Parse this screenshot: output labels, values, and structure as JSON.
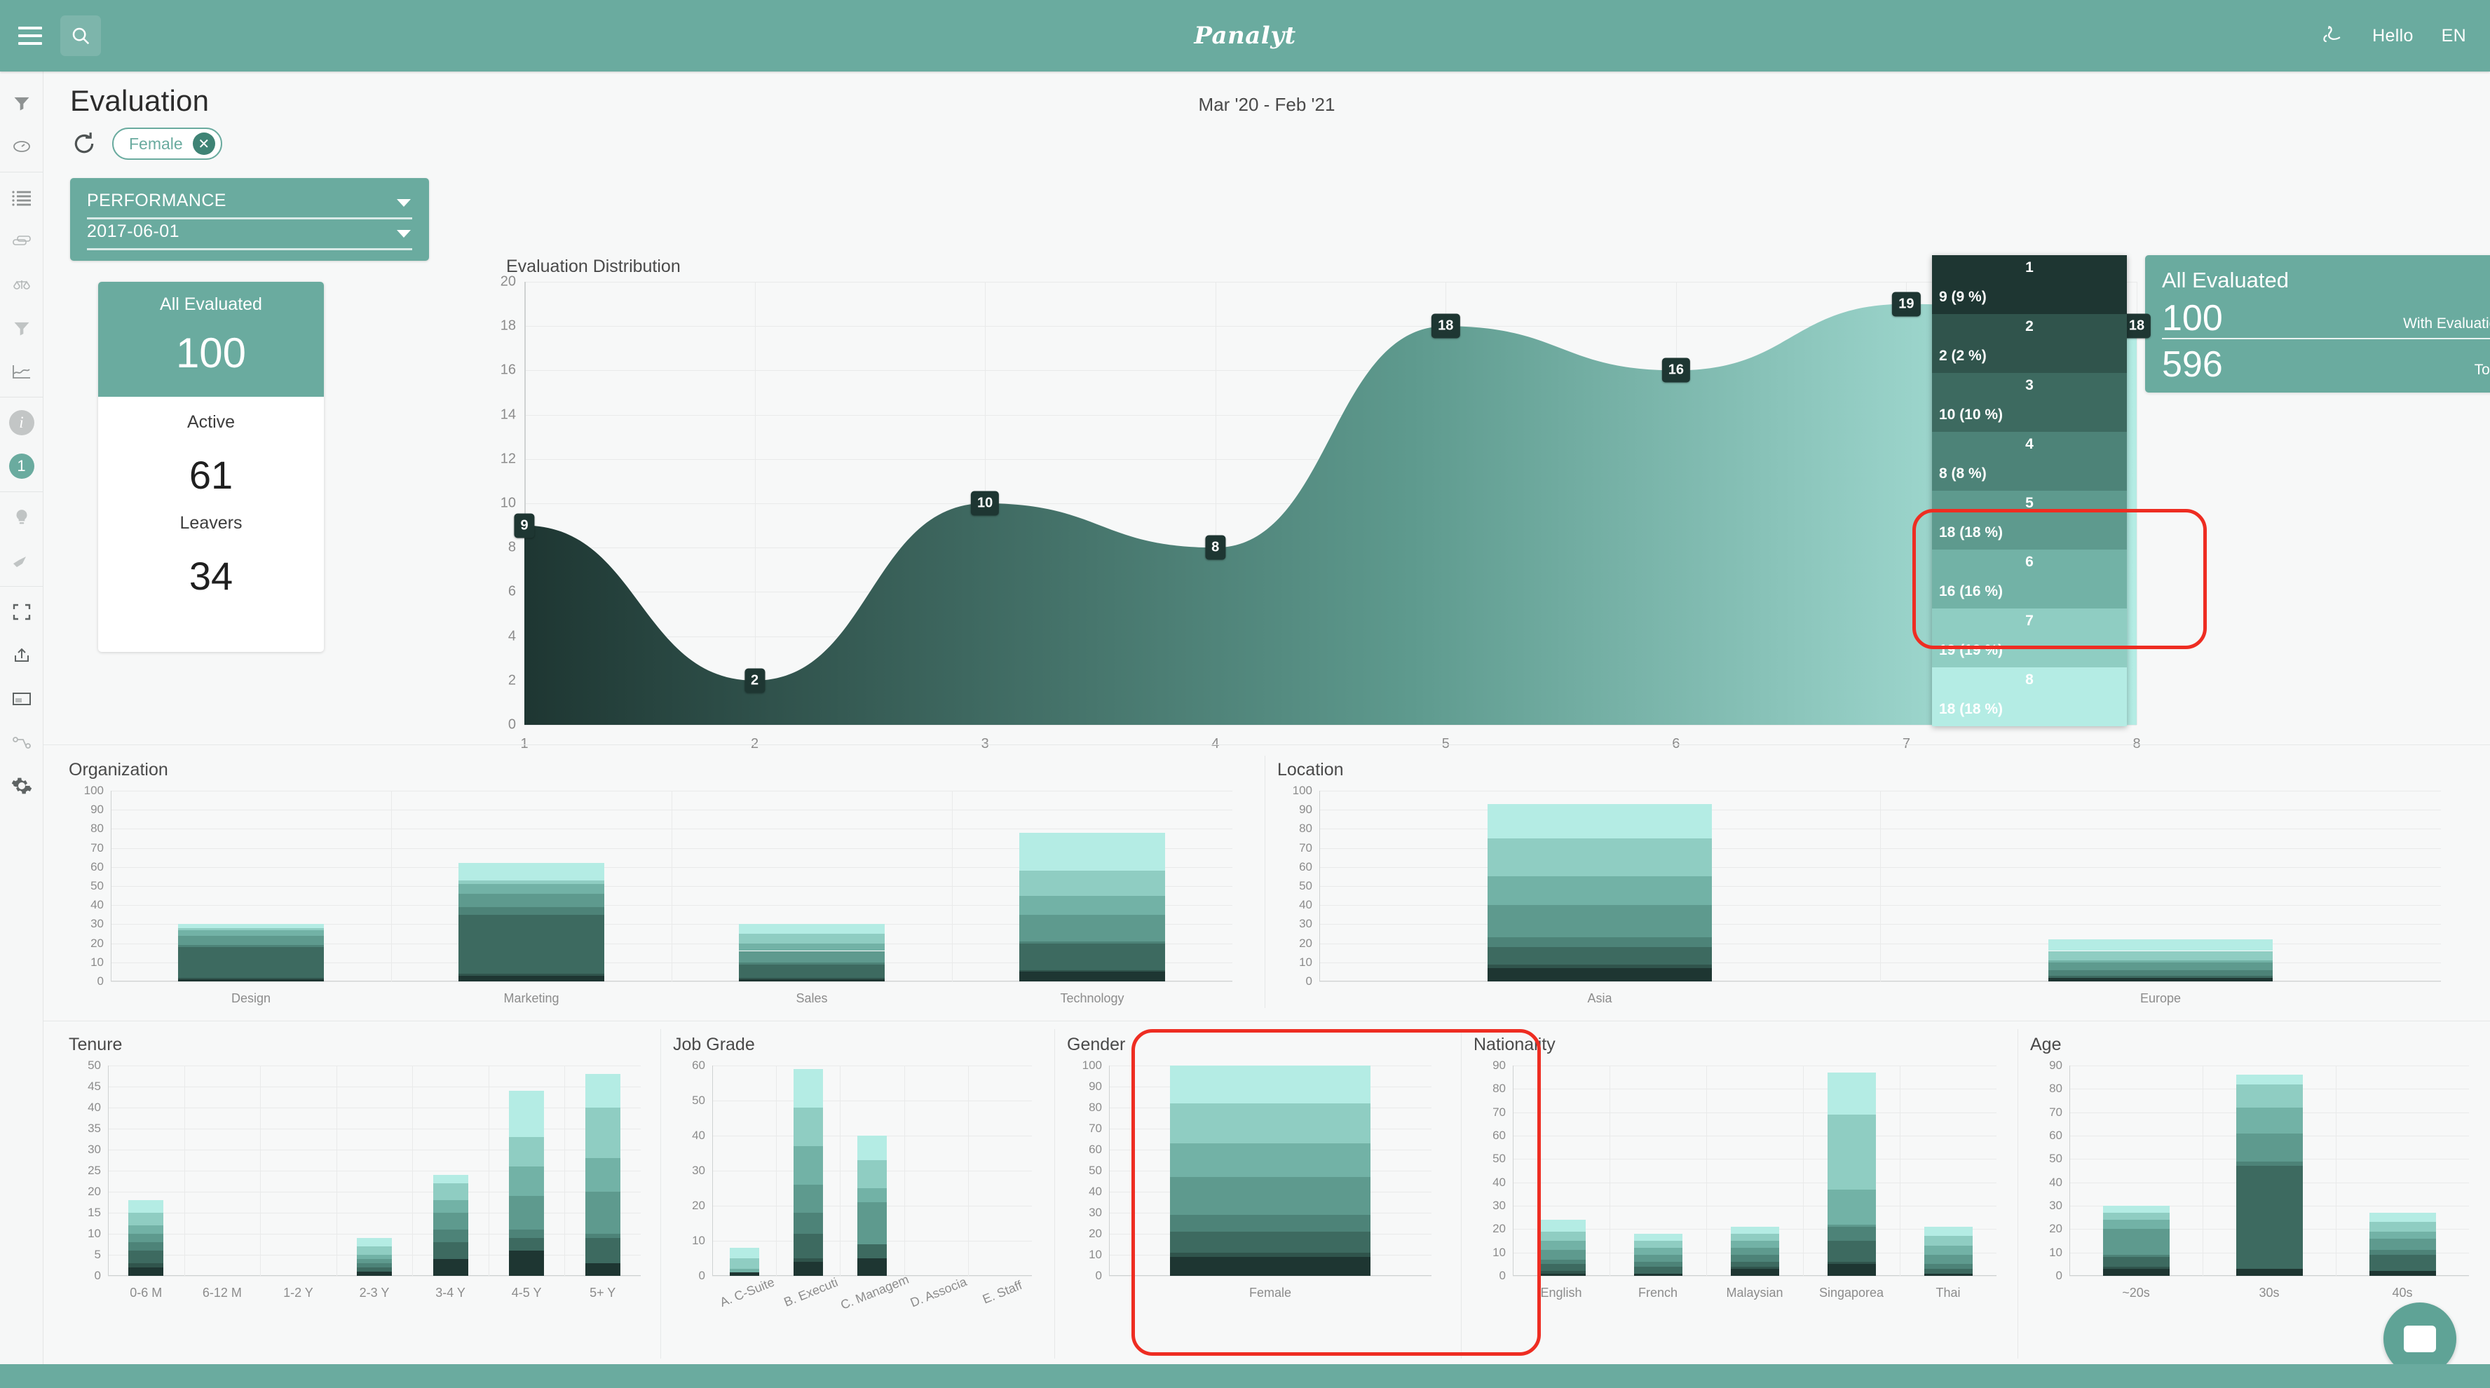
{
  "header": {
    "logo": "Panalyt",
    "logo_icon": "panalyt-script-logo",
    "menu_icon": "hamburger-menu-icon",
    "search_icon": "search-icon",
    "bird_icon": "swan-icon",
    "hello": "Hello",
    "lang": "EN"
  },
  "sidebar": {
    "items": [
      {
        "name": "filter-icon",
        "label": "Filter"
      },
      {
        "name": "clock-history-icon",
        "label": "History"
      },
      {
        "name": "list-icon",
        "label": "List"
      },
      {
        "name": "layers-icon",
        "label": "Layers"
      },
      {
        "name": "balance-scale-icon",
        "label": "Compare"
      },
      {
        "name": "funnel-icon",
        "label": "Funnel"
      },
      {
        "name": "chart-line-icon",
        "label": "Trends"
      },
      {
        "name": "info-icon",
        "label": "Info"
      },
      {
        "name": "notification-count-icon",
        "label": "1"
      },
      {
        "name": "lightbulb-icon",
        "label": "Insights"
      },
      {
        "name": "rocket-icon",
        "label": "Launch"
      },
      {
        "name": "fullscreen-icon",
        "label": "Fullscreen"
      },
      {
        "name": "upload-share-icon",
        "label": "Share"
      },
      {
        "name": "presentation-icon",
        "label": "Present"
      },
      {
        "name": "node-link-icon",
        "label": "Network"
      },
      {
        "name": "gear-icon",
        "label": "Settings"
      }
    ],
    "notification_count": "1"
  },
  "page": {
    "title": "Evaluation",
    "date_range": "Mar '20 - Feb '21",
    "reload_icon": "reload-icon",
    "filter_chip": {
      "label": "Female",
      "remove_icon": "close-icon"
    }
  },
  "selectors": {
    "metric": "PERFORMANCE",
    "date": "2017-06-01",
    "caret_icon": "chevron-down-icon"
  },
  "kpi_card": {
    "header_label": "All Evaluated",
    "header_value": "100",
    "rows": [
      {
        "label": "Active",
        "value": "61"
      },
      {
        "label": "Leavers",
        "value": "34"
      }
    ]
  },
  "banner": {
    "title": "All Evaluated",
    "with_evaluation_value": "100",
    "with_evaluation_label": "With Evaluation",
    "total_value": "596",
    "total_label": "Total"
  },
  "tooltip": {
    "rows": [
      {
        "key": "1",
        "value": "9 (9 %)",
        "color": "#1e3632"
      },
      {
        "key": "2",
        "value": "2 (2 %)",
        "color": "#30544c"
      },
      {
        "key": "3",
        "value": "10 (10 %)",
        "color": "#3d6a60"
      },
      {
        "key": "4",
        "value": "8 (8 %)",
        "color": "#4d8378"
      },
      {
        "key": "5",
        "value": "18 (18 %)",
        "color": "#5e9a8e"
      },
      {
        "key": "6",
        "value": "16 (16 %)",
        "color": "#72b2a6"
      },
      {
        "key": "7",
        "value": "19 (19 %)",
        "color": "#8fcdc2"
      },
      {
        "key": "8",
        "value": "18 (18 %)",
        "color": "#b4ece4"
      }
    ]
  },
  "palette": {
    "brand": "#6aab9f",
    "dark": "#1e3632",
    "light": "#b4ece4",
    "highlight": "#ee2d22",
    "ramp": [
      "#1e3632",
      "#2c4b44",
      "#3a6056",
      "#487569",
      "#5a8d81",
      "#6ea79a",
      "#85c2b6",
      "#a9e2d9",
      "#b9eee6"
    ]
  },
  "chart_data": [
    {
      "type": "area",
      "title": "Evaluation Distribution",
      "categories": [
        "1",
        "2",
        "3",
        "4",
        "5",
        "6",
        "7",
        "8"
      ],
      "values": [
        9,
        2,
        10,
        8,
        18,
        16,
        19,
        18
      ],
      "xlabel": "",
      "ylabel": "",
      "ylim": [
        0,
        20
      ],
      "yticks": [
        0,
        2,
        4,
        6,
        8,
        10,
        12,
        14,
        16,
        18,
        20
      ],
      "grid": true,
      "legend": "none",
      "point_labels": [
        "9",
        "2",
        "10",
        "8",
        "18",
        "16",
        "19",
        "18"
      ]
    },
    {
      "type": "bar",
      "title": "Organization",
      "stacked": true,
      "categories": [
        "Design",
        "Marketing",
        "Sales",
        "Technology"
      ],
      "values": [
        30,
        62,
        30,
        78
      ],
      "ylim": [
        0,
        100
      ],
      "yticks": [
        0,
        10,
        20,
        30,
        40,
        50,
        60,
        70,
        80,
        90,
        100
      ],
      "series": [
        {
          "name": "1",
          "values": [
            1,
            3,
            1,
            5
          ]
        },
        {
          "name": "2",
          "values": [
            1,
            1,
            1,
            1
          ]
        },
        {
          "name": "3",
          "values": [
            16,
            31,
            7,
            14
          ]
        },
        {
          "name": "4",
          "values": [
            1,
            4,
            1,
            1
          ]
        },
        {
          "name": "5",
          "values": [
            5,
            7,
            6,
            14
          ]
        },
        {
          "name": "6",
          "values": [
            3,
            5,
            4,
            10
          ]
        },
        {
          "name": "7",
          "values": [
            1,
            2,
            5,
            13
          ]
        },
        {
          "name": "8",
          "values": [
            2,
            9,
            5,
            20
          ]
        }
      ]
    },
    {
      "type": "bar",
      "title": "Location",
      "stacked": true,
      "categories": [
        "Asia",
        "Europe"
      ],
      "values": [
        93,
        22
      ],
      "ylim": [
        0,
        100
      ],
      "yticks": [
        0,
        10,
        20,
        30,
        40,
        50,
        60,
        70,
        80,
        90,
        100
      ],
      "series": [
        {
          "name": "1",
          "values": [
            7,
            2
          ]
        },
        {
          "name": "2",
          "values": [
            2,
            0
          ]
        },
        {
          "name": "3",
          "values": [
            9,
            1
          ]
        },
        {
          "name": "4",
          "values": [
            5,
            3
          ]
        },
        {
          "name": "5",
          "values": [
            17,
            4
          ]
        },
        {
          "name": "6",
          "values": [
            15,
            1
          ]
        },
        {
          "name": "7",
          "values": [
            20,
            5
          ]
        },
        {
          "name": "8",
          "values": [
            18,
            6
          ]
        }
      ]
    },
    {
      "type": "bar",
      "title": "Tenure",
      "stacked": true,
      "categories": [
        "0-6 M",
        "6-12 M",
        "1-2 Y",
        "2-3 Y",
        "3-4 Y",
        "4-5 Y",
        "5+ Y"
      ],
      "values": [
        18,
        0,
        0,
        8,
        24,
        44,
        48
      ],
      "ylim": [
        0,
        50
      ],
      "yticks": [
        0,
        5,
        10,
        15,
        20,
        25,
        30,
        35,
        40,
        45,
        50
      ],
      "series": [
        {
          "name": "1",
          "values": [
            2,
            0,
            0,
            1,
            4,
            6,
            3
          ]
        },
        {
          "name": "2",
          "values": [
            1,
            0,
            0,
            0,
            0,
            0,
            0
          ]
        },
        {
          "name": "3",
          "values": [
            3,
            0,
            0,
            1,
            4,
            3,
            6
          ]
        },
        {
          "name": "4",
          "values": [
            2,
            0,
            0,
            1,
            3,
            2,
            1
          ]
        },
        {
          "name": "5",
          "values": [
            2,
            0,
            0,
            1,
            4,
            8,
            10
          ]
        },
        {
          "name": "6",
          "values": [
            2,
            0,
            0,
            1,
            3,
            7,
            8
          ]
        },
        {
          "name": "7",
          "values": [
            3,
            0,
            0,
            2,
            4,
            7,
            12
          ]
        },
        {
          "name": "8",
          "values": [
            3,
            0,
            0,
            2,
            2,
            11,
            8
          ]
        }
      ]
    },
    {
      "type": "bar",
      "title": "Job Grade",
      "stacked": true,
      "categories": [
        "A. C-Suite",
        "B. Executi",
        "C. Managem",
        "D. Associa",
        "E. Staff"
      ],
      "values": [
        8,
        59,
        40,
        0,
        0
      ],
      "ylim": [
        0,
        60
      ],
      "yticks": [
        0,
        10,
        20,
        30,
        40,
        50,
        60
      ],
      "series": [
        {
          "name": "1",
          "values": [
            1,
            4,
            5,
            0,
            0
          ]
        },
        {
          "name": "2",
          "values": [
            0,
            1,
            0,
            0,
            0
          ]
        },
        {
          "name": "3",
          "values": [
            0,
            7,
            4,
            0,
            0
          ]
        },
        {
          "name": "4",
          "values": [
            0,
            6,
            0,
            0,
            0
          ]
        },
        {
          "name": "5",
          "values": [
            0,
            8,
            12,
            0,
            0
          ]
        },
        {
          "name": "6",
          "values": [
            1,
            11,
            4,
            0,
            0
          ]
        },
        {
          "name": "7",
          "values": [
            3,
            11,
            8,
            0,
            0
          ]
        },
        {
          "name": "8",
          "values": [
            3,
            11,
            7,
            0,
            0
          ]
        }
      ]
    },
    {
      "type": "bar",
      "title": "Gender",
      "stacked": true,
      "categories": [
        "Female"
      ],
      "values": [
        100
      ],
      "ylim": [
        0,
        100
      ],
      "yticks": [
        0,
        10,
        20,
        30,
        40,
        50,
        60,
        70,
        80,
        90,
        100
      ],
      "series": [
        {
          "name": "1",
          "values": [
            9
          ]
        },
        {
          "name": "2",
          "values": [
            2
          ]
        },
        {
          "name": "3",
          "values": [
            10
          ]
        },
        {
          "name": "4",
          "values": [
            8
          ]
        },
        {
          "name": "5",
          "values": [
            18
          ]
        },
        {
          "name": "6",
          "values": [
            16
          ]
        },
        {
          "name": "7",
          "values": [
            19
          ]
        },
        {
          "name": "8",
          "values": [
            18
          ]
        }
      ]
    },
    {
      "type": "bar",
      "title": "Nationality",
      "stacked": true,
      "categories": [
        "English",
        "French",
        "Malaysian",
        "Singaporea",
        "Thai"
      ],
      "values": [
        24,
        18,
        21,
        87,
        21
      ],
      "ylim": [
        0,
        90
      ],
      "yticks": [
        0,
        10,
        20,
        30,
        40,
        50,
        60,
        70,
        80,
        90
      ],
      "series": [
        {
          "name": "1",
          "values": [
            1,
            1,
            3,
            5,
            1
          ]
        },
        {
          "name": "2",
          "values": [
            1,
            0,
            1,
            1,
            0
          ]
        },
        {
          "name": "3",
          "values": [
            3,
            3,
            2,
            9,
            2
          ]
        },
        {
          "name": "4",
          "values": [
            2,
            2,
            3,
            6,
            2
          ]
        },
        {
          "name": "5",
          "values": [
            4,
            3,
            3,
            1,
            4
          ]
        },
        {
          "name": "6",
          "values": [
            4,
            3,
            3,
            15,
            4
          ]
        },
        {
          "name": "7",
          "values": [
            4,
            3,
            3,
            32,
            4
          ]
        },
        {
          "name": "8",
          "values": [
            5,
            3,
            3,
            18,
            4
          ]
        }
      ]
    },
    {
      "type": "bar",
      "title": "Age",
      "stacked": true,
      "categories": [
        "~20s",
        "30s",
        "40s"
      ],
      "values": [
        30,
        86,
        27
      ],
      "ylim": [
        0,
        90
      ],
      "yticks": [
        0,
        10,
        20,
        30,
        40,
        50,
        60,
        70,
        80,
        90
      ],
      "series": [
        {
          "name": "1",
          "values": [
            3,
            3,
            2
          ]
        },
        {
          "name": "2",
          "values": [
            1,
            0,
            0
          ]
        },
        {
          "name": "3",
          "values": [
            4,
            44,
            7
          ]
        },
        {
          "name": "4",
          "values": [
            1,
            2,
            2
          ]
        },
        {
          "name": "5",
          "values": [
            11,
            12,
            5
          ]
        },
        {
          "name": "6",
          "values": [
            4,
            11,
            3
          ]
        },
        {
          "name": "7",
          "values": [
            3,
            10,
            4
          ]
        },
        {
          "name": "8",
          "values": [
            3,
            4,
            4
          ]
        }
      ]
    }
  ],
  "chat": {
    "icon": "chat-bubble-icon"
  }
}
